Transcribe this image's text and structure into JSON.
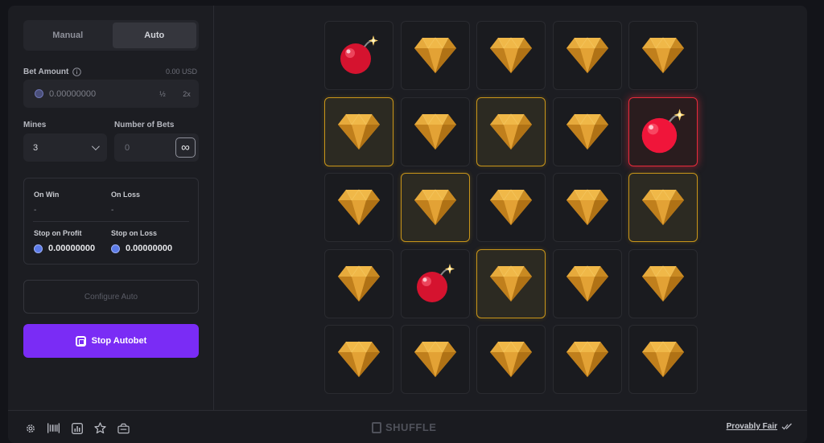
{
  "tabs": [
    {
      "label": "Manual",
      "active": false
    },
    {
      "label": "Auto",
      "active": true
    }
  ],
  "bet": {
    "label": "Bet Amount",
    "info_icon": "info-icon",
    "usd": "0.00 USD",
    "value": "0.00000000",
    "half_label": "½",
    "double_label": "2x"
  },
  "mines": {
    "label": "Mines",
    "value": "3"
  },
  "number_of_bets": {
    "label": "Number of Bets",
    "value": "0",
    "infinite_symbol": "∞"
  },
  "auto_panel": {
    "on_win_label": "On Win",
    "on_win_value": "-",
    "on_loss_label": "On Loss",
    "on_loss_value": "-",
    "stop_profit_label": "Stop on Profit",
    "stop_profit_value": "0.00000000",
    "stop_loss_label": "Stop on Loss",
    "stop_loss_value": "0.00000000"
  },
  "configure_label": "Configure Auto",
  "stop_label": "Stop Autobet",
  "grid": [
    [
      "bomb",
      "gem",
      "gem",
      "gem",
      "gem"
    ],
    [
      "gem-win",
      "gem",
      "gem-win",
      "gem",
      "bomb-hit"
    ],
    [
      "gem",
      "gem-win",
      "gem",
      "gem",
      "gem-win"
    ],
    [
      "gem",
      "bomb",
      "gem-win",
      "gem",
      "gem"
    ],
    [
      "gem",
      "gem",
      "gem",
      "gem",
      "gem"
    ]
  ],
  "footer": {
    "icons": [
      "settings-icon",
      "barcode-icon",
      "stats-icon",
      "star-icon",
      "ticket-icon"
    ],
    "brand": "SHUFFLE",
    "provably_fair": "Provably Fair"
  },
  "colors": {
    "accent": "#7a2cf5",
    "win_border": "#c99519",
    "loss_border": "#e82a3b",
    "gem": "#e0a030",
    "bomb": "#e81f3c"
  }
}
